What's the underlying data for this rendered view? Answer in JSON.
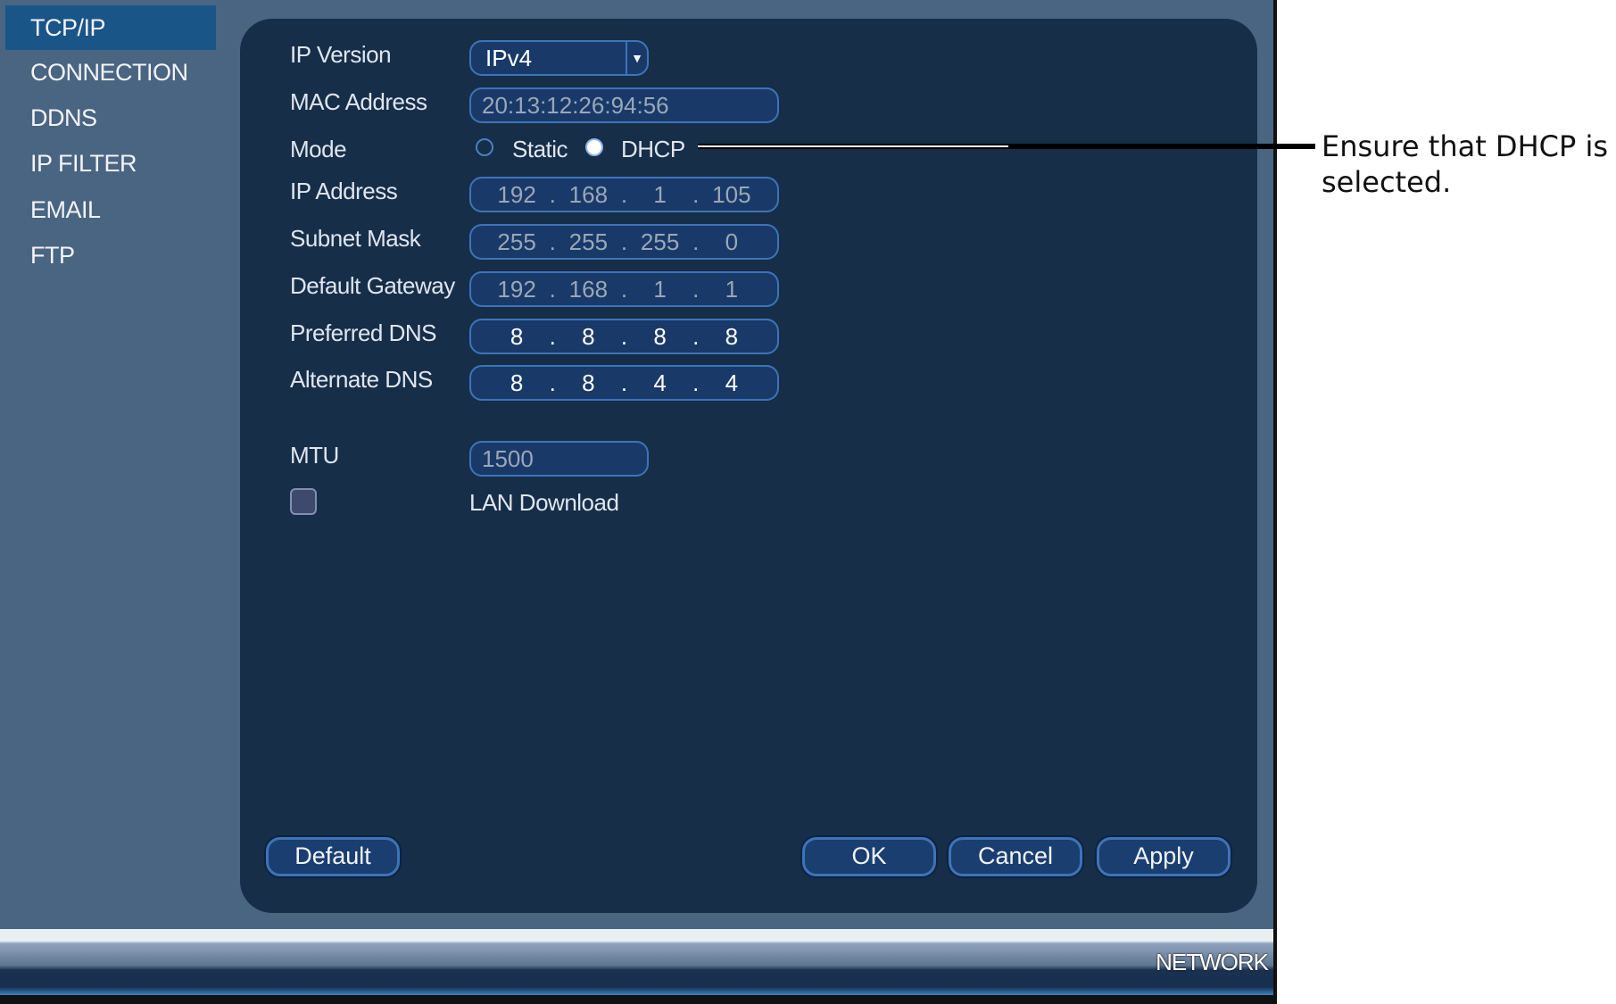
{
  "sidebar": {
    "items": [
      {
        "label": "TCP/IP",
        "selected": true
      },
      {
        "label": "CONNECTION"
      },
      {
        "label": "DDNS"
      },
      {
        "label": "IP FILTER"
      },
      {
        "label": "EMAIL"
      },
      {
        "label": "FTP"
      }
    ]
  },
  "form": {
    "ip_version": {
      "label": "IP Version",
      "value": "IPv4"
    },
    "mac": {
      "label": "MAC Address",
      "value": "20:13:12:26:94:56"
    },
    "mode": {
      "label": "Mode",
      "options": [
        "Static",
        "DHCP"
      ],
      "selected": "DHCP"
    },
    "ip_address": {
      "label": "IP Address",
      "octets": [
        "192",
        "168",
        "1",
        "105"
      ]
    },
    "subnet": {
      "label": "Subnet Mask",
      "octets": [
        "255",
        "255",
        "255",
        "0"
      ]
    },
    "gateway": {
      "label": "Default Gateway",
      "octets": [
        "192",
        "168",
        "1",
        "1"
      ]
    },
    "dns1": {
      "label": "Preferred DNS",
      "octets": [
        "8",
        "8",
        "8",
        "8"
      ]
    },
    "dns2": {
      "label": "Alternate DNS",
      "octets": [
        "8",
        "8",
        "4",
        "4"
      ]
    },
    "mtu": {
      "label": "MTU",
      "value": "1500"
    },
    "lan_download": {
      "label": "LAN Download",
      "checked": false
    },
    "dot": "."
  },
  "buttons": {
    "default": "Default",
    "ok": "OK",
    "cancel": "Cancel",
    "apply": "Apply"
  },
  "footer": {
    "section": "NETWORK"
  },
  "annotation": {
    "line1": "Ensure that DHCP is",
    "line2": "selected."
  },
  "colors": {
    "background": "#4a6582",
    "panel": "#162e48",
    "selected": "#1a5588",
    "field": "#193a68"
  }
}
